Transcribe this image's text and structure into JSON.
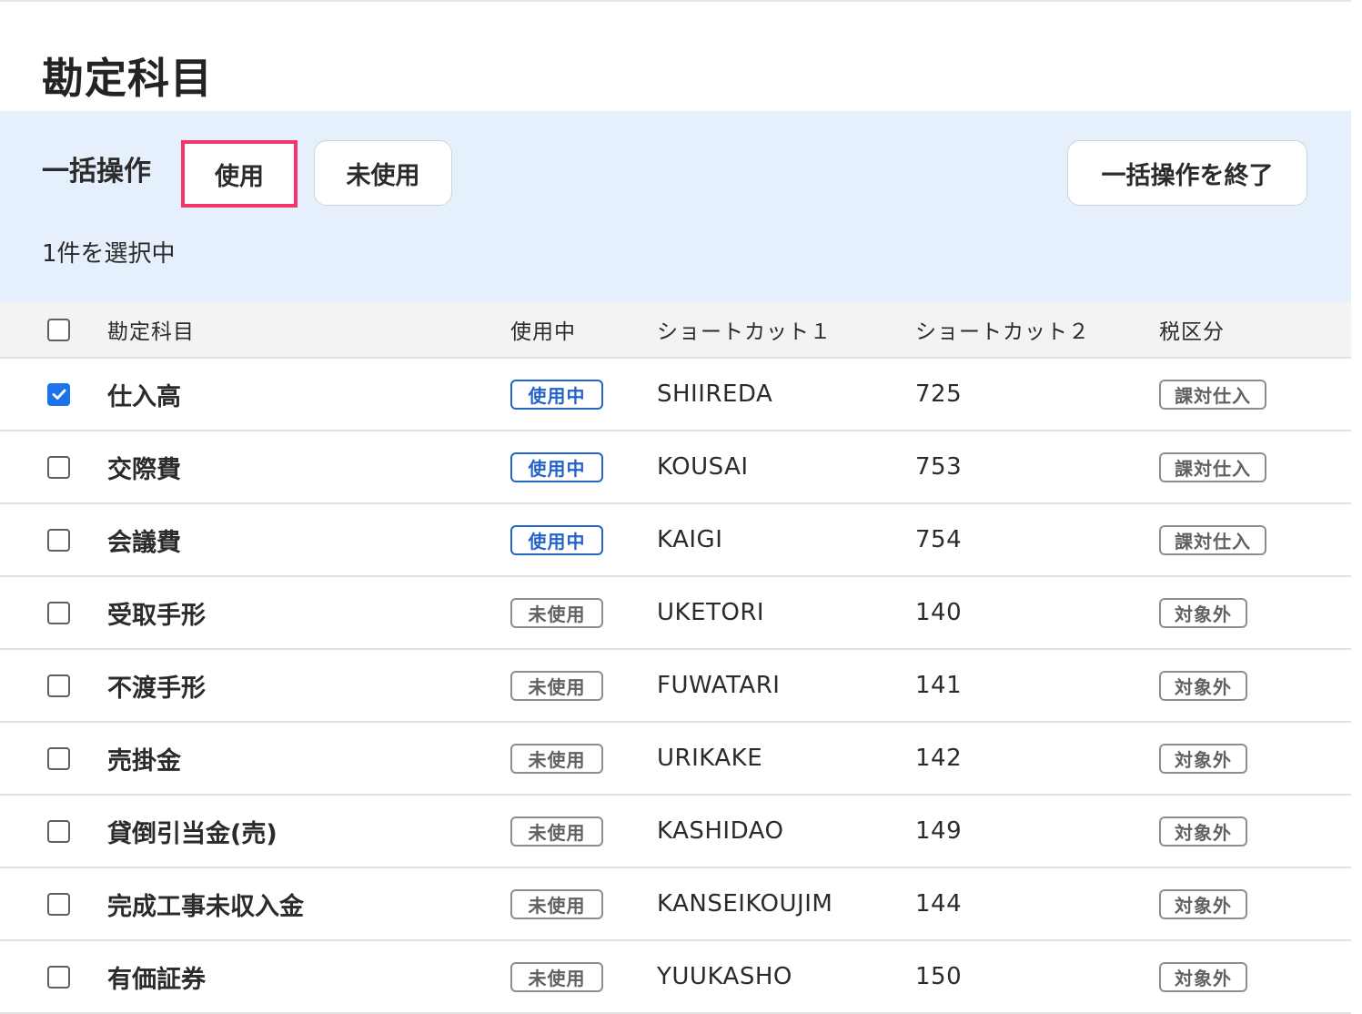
{
  "page": {
    "title": "勘定科目"
  },
  "bulk": {
    "label": "一括操作",
    "use_button": "使用",
    "unused_button": "未使用",
    "end_button": "一括操作を終了",
    "selected_text": "1件を選択中"
  },
  "table": {
    "headers": {
      "name": "勘定科目",
      "status": "使用中",
      "shortcut1": "ショートカット１",
      "shortcut2": "ショートカット２",
      "tax": "税区分"
    },
    "rows": [
      {
        "checked": true,
        "name": "仕入高",
        "status": "使用中",
        "status_active": true,
        "shortcut1": "SHIIREDA",
        "shortcut2": "725",
        "tax": "課対仕入"
      },
      {
        "checked": false,
        "name": "交際費",
        "status": "使用中",
        "status_active": true,
        "shortcut1": "KOUSAI",
        "shortcut2": "753",
        "tax": "課対仕入"
      },
      {
        "checked": false,
        "name": "会議費",
        "status": "使用中",
        "status_active": true,
        "shortcut1": "KAIGI",
        "shortcut2": "754",
        "tax": "課対仕入"
      },
      {
        "checked": false,
        "name": "受取手形",
        "status": "未使用",
        "status_active": false,
        "shortcut1": "UKETORI",
        "shortcut2": "140",
        "tax": "対象外"
      },
      {
        "checked": false,
        "name": "不渡手形",
        "status": "未使用",
        "status_active": false,
        "shortcut1": "FUWATARI",
        "shortcut2": "141",
        "tax": "対象外"
      },
      {
        "checked": false,
        "name": "売掛金",
        "status": "未使用",
        "status_active": false,
        "shortcut1": "URIKAKE",
        "shortcut2": "142",
        "tax": "対象外"
      },
      {
        "checked": false,
        "name": "貸倒引当金(売)",
        "status": "未使用",
        "status_active": false,
        "shortcut1": "KASHIDAO",
        "shortcut2": "149",
        "tax": "対象外"
      },
      {
        "checked": false,
        "name": "完成工事未収入金",
        "status": "未使用",
        "status_active": false,
        "shortcut1": "KANSEIKOUJIM",
        "shortcut2": "144",
        "tax": "対象外"
      },
      {
        "checked": false,
        "name": "有価証券",
        "status": "未使用",
        "status_active": false,
        "shortcut1": "YUUKASHO",
        "shortcut2": "150",
        "tax": "対象外"
      }
    ]
  },
  "colors": {
    "accent_blue": "#1a73e8",
    "active_badge": "#2563c9",
    "highlight": "#f2356b",
    "panel_bg": "#e6f0fd"
  }
}
